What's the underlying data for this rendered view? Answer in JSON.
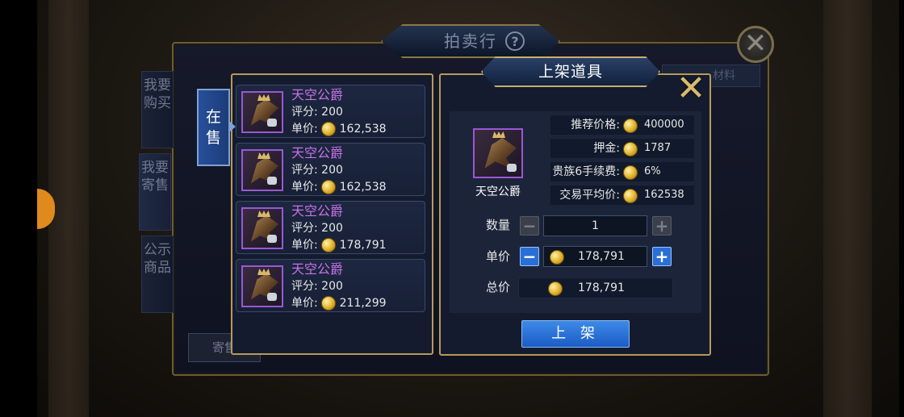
{
  "window": {
    "title": "拍卖行",
    "help_icon": "?",
    "close_icon": "✕",
    "side_tabs": [
      "我要购买",
      "我要寄售",
      "公示商品"
    ],
    "consign_button": "寄售",
    "partial_tab_text": "材料"
  },
  "listings": {
    "tab_label": "在售",
    "items": [
      {
        "name": "天空公爵",
        "score_label": "评分:",
        "score": "200",
        "price_label": "单价:",
        "price": "162,538"
      },
      {
        "name": "天空公爵",
        "score_label": "评分:",
        "score": "200",
        "price_label": "单价:",
        "price": "162,538"
      },
      {
        "name": "天空公爵",
        "score_label": "评分:",
        "score": "200",
        "price_label": "单价:",
        "price": "178,791"
      },
      {
        "name": "天空公爵",
        "score_label": "评分:",
        "score": "200",
        "price_label": "单价:",
        "price": "211,299"
      }
    ]
  },
  "dialog": {
    "title": "上架道具",
    "close_icon": "✕",
    "item_name": "天空公爵",
    "info": [
      {
        "label": "推荐价格:",
        "value": "400000"
      },
      {
        "label": "押金:",
        "value": "1787"
      },
      {
        "label": "贵族6手续费:",
        "value": "6%"
      },
      {
        "label": "交易平均价:",
        "value": "162538"
      }
    ],
    "quantity_label": "数量",
    "quantity": "1",
    "unit_price_label": "单价",
    "unit_price": "178,791",
    "total_label": "总价",
    "total": "178,791",
    "minus": "−",
    "plus": "+",
    "submit": "上 架"
  },
  "colors": {
    "accent_gold": "#b59a5a",
    "item_purple": "#c772e6",
    "button_blue": "#2a6fd6"
  },
  "icons": [
    "help-icon",
    "close-icon",
    "coin-icon",
    "item-icon",
    "minus-icon",
    "plus-icon"
  ]
}
